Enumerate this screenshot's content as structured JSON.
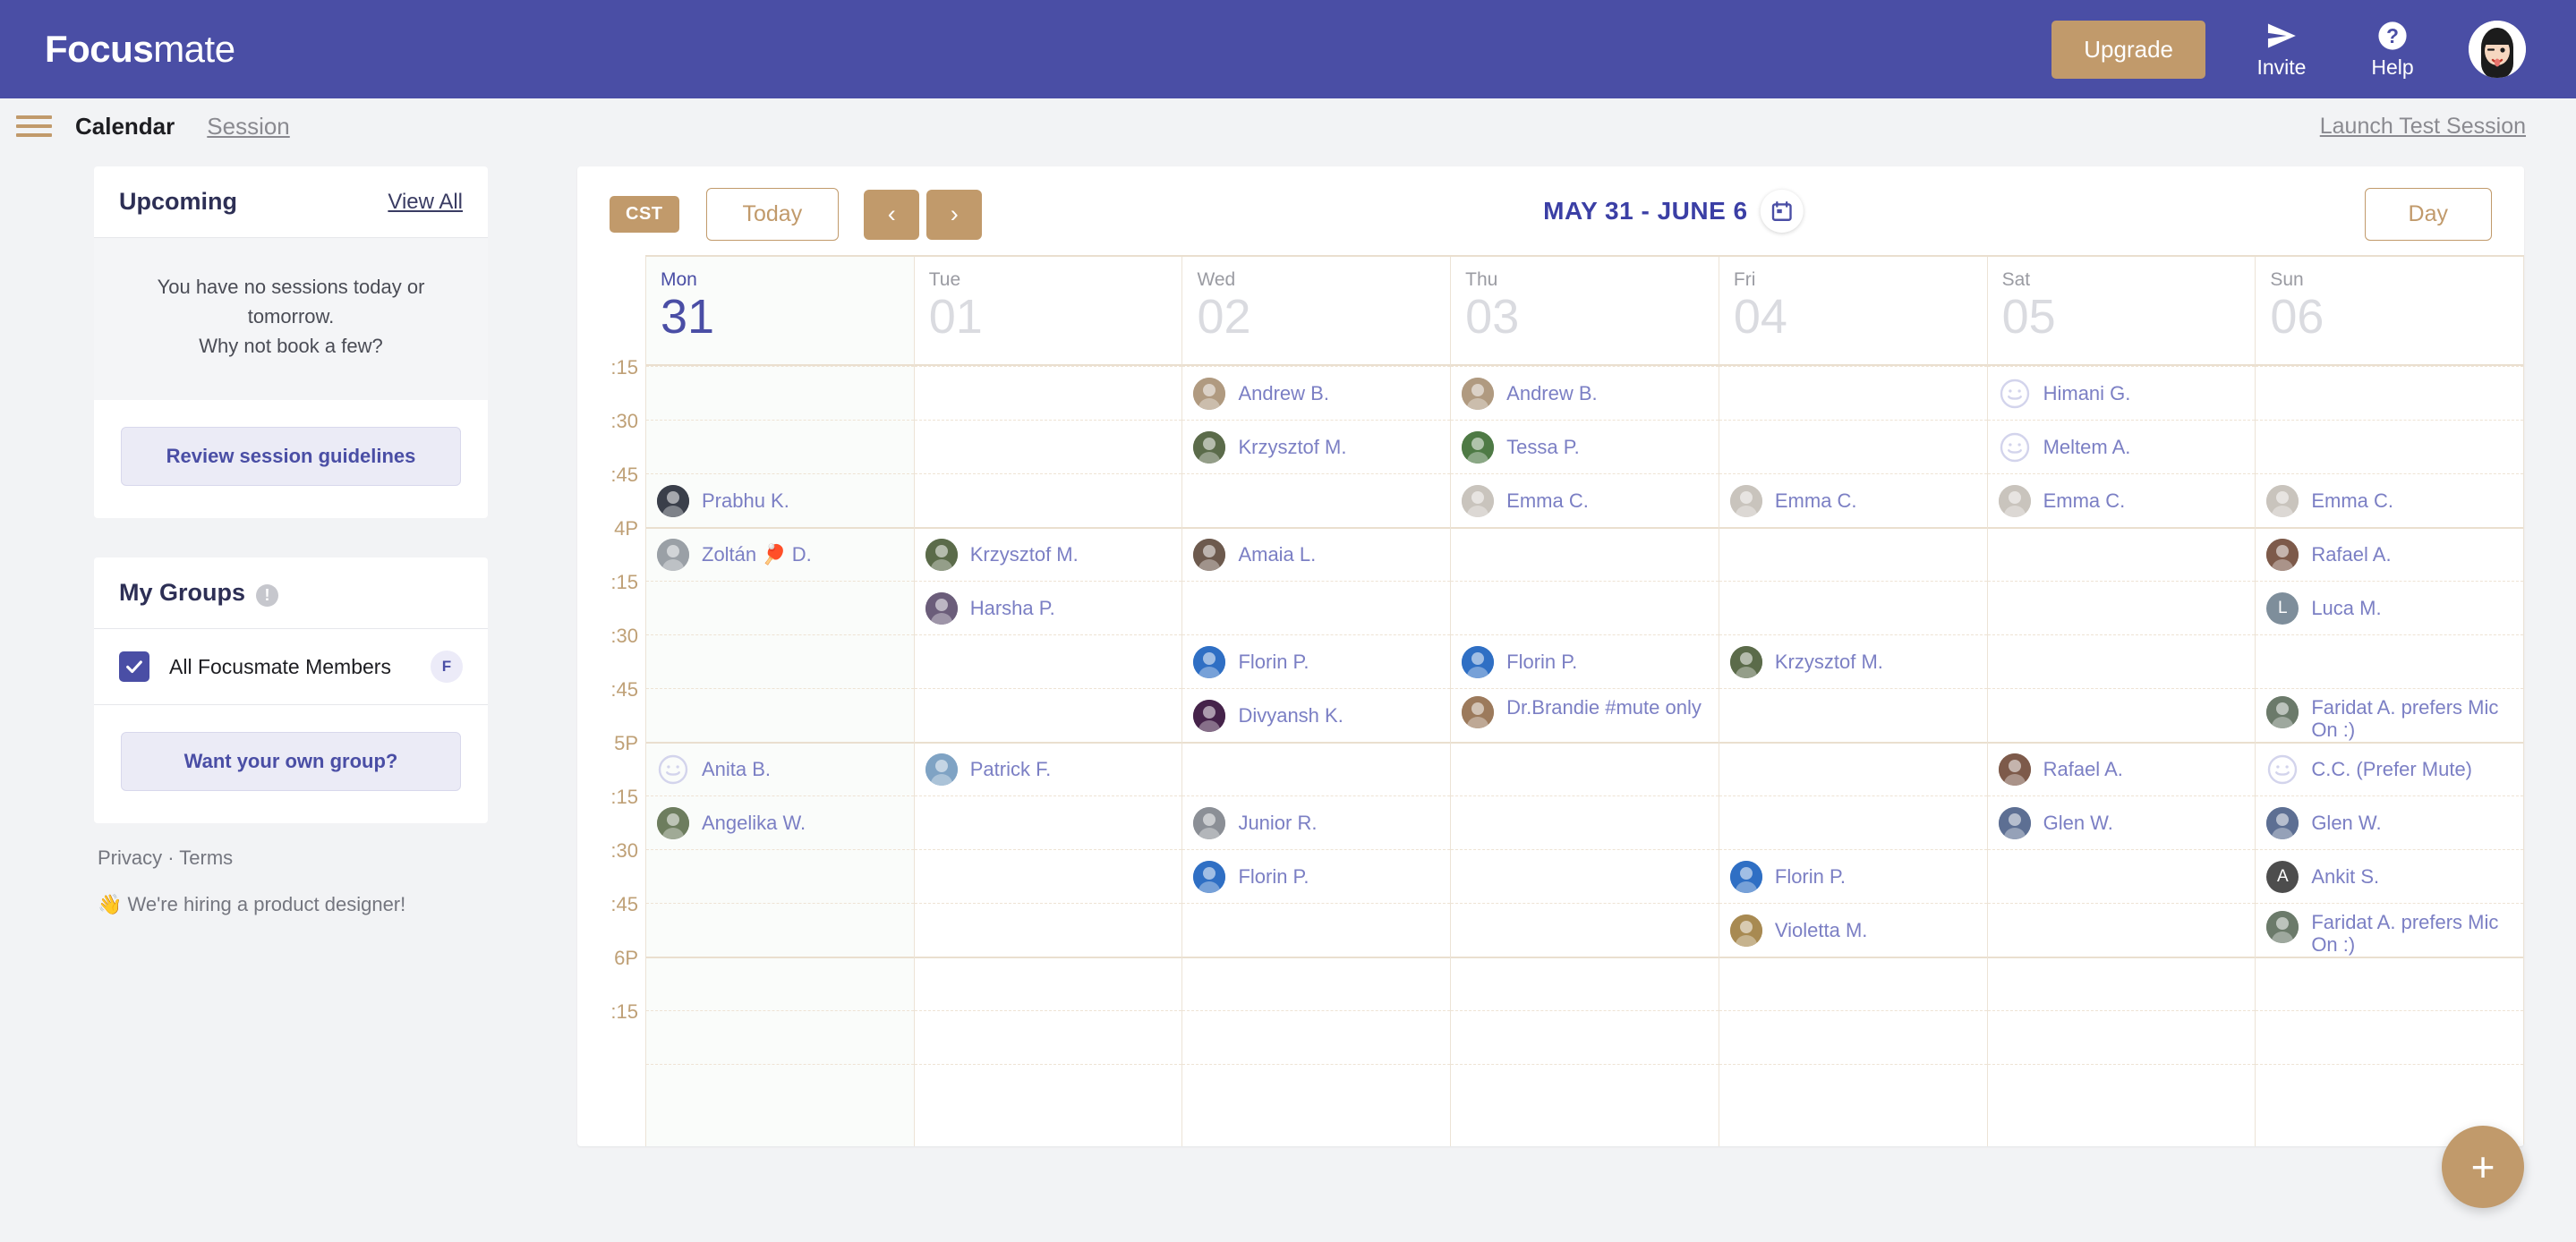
{
  "topnav": {
    "logo_bold": "Focus",
    "logo_light": "mate",
    "upgrade_label": "Upgrade",
    "invite_label": "Invite",
    "help_label": "Help",
    "invite_icon": "paper-plane-icon",
    "help_icon": "question-circle-icon",
    "avatar": "user-avatar",
    "bg_color": "#4a4ea5",
    "accent_color": "#c19a6b"
  },
  "subnav": {
    "menu_icon": "hamburger-menu-icon",
    "tabs": [
      {
        "label": "Calendar",
        "active": true
      },
      {
        "label": "Session",
        "active": false
      }
    ],
    "launch_test_session": "Launch Test Session"
  },
  "sidebar": {
    "upcoming": {
      "title": "Upcoming",
      "view_all": "View All",
      "empty_line1": "You have no sessions today or tomorrow.",
      "empty_line2": "Why not book a few?",
      "review_button": "Review session guidelines"
    },
    "groups": {
      "title": "My Groups",
      "info_icon": "info-icon",
      "items": [
        {
          "name": "All Focusmate Members",
          "checked": true,
          "badge": "F"
        }
      ],
      "own_group_button": "Want your own group?"
    },
    "footer": {
      "privacy": "Privacy",
      "separator": "·",
      "terms": "Terms",
      "hiring": "👋 We're hiring a product designer!"
    }
  },
  "calendar": {
    "timezone_badge": "CST",
    "today_label": "Today",
    "prev_icon": "chevron-left-icon",
    "next_icon": "chevron-right-icon",
    "prev_label": "‹",
    "next_label": "›",
    "date_range": "MAY 31 - JUNE 6",
    "date_picker_icon": "calendar-icon",
    "view_label": "Day",
    "add_session_label": "+",
    "time_labels": [
      ":15",
      ":30",
      ":45",
      "4P",
      ":15",
      ":30",
      ":45",
      "5P",
      ":15",
      ":30",
      ":45",
      "6P",
      ":15"
    ],
    "days": [
      {
        "dow": "Mon",
        "date": "31",
        "today": true
      },
      {
        "dow": "Tue",
        "date": "01",
        "today": false
      },
      {
        "dow": "Wed",
        "date": "02",
        "today": false
      },
      {
        "dow": "Thu",
        "date": "03",
        "today": false
      },
      {
        "dow": "Fri",
        "date": "04",
        "today": false
      },
      {
        "dow": "Sat",
        "date": "05",
        "today": false
      },
      {
        "dow": "Sun",
        "date": "06",
        "today": false
      }
    ],
    "sessions": [
      {
        "day": 0,
        "slot": 2,
        "name": "Prabhu K.",
        "avatar": "photo",
        "color": "#3a3f4a"
      },
      {
        "day": 0,
        "slot": 3,
        "name": "Zoltán 🏓 D.",
        "avatar": "photo",
        "color": "#9aa0a6"
      },
      {
        "day": 0,
        "slot": 7,
        "name": "Anita B.",
        "avatar": "smiley",
        "color": "#d3d4ec"
      },
      {
        "day": 0,
        "slot": 8,
        "name": "Angelika W.",
        "avatar": "photo",
        "color": "#6d7d5e"
      },
      {
        "day": 1,
        "slot": 3,
        "name": "Krzysztof M.",
        "avatar": "photo",
        "color": "#5b6b4a"
      },
      {
        "day": 1,
        "slot": 4,
        "name": "Harsha P.",
        "avatar": "photo",
        "color": "#6b5d7a"
      },
      {
        "day": 1,
        "slot": 7,
        "name": "Patrick F.",
        "avatar": "photo",
        "color": "#7fa3c4"
      },
      {
        "day": 2,
        "slot": 0,
        "name": "Andrew B.",
        "avatar": "photo",
        "color": "#b09a80"
      },
      {
        "day": 2,
        "slot": 1,
        "name": "Krzysztof M.",
        "avatar": "photo",
        "color": "#5b6b4a"
      },
      {
        "day": 2,
        "slot": 3,
        "name": "Amaia L.",
        "avatar": "photo",
        "color": "#6d5a4e"
      },
      {
        "day": 2,
        "slot": 5,
        "name": "Florin P.",
        "avatar": "photo",
        "color": "#2f6fc4"
      },
      {
        "day": 2,
        "slot": 6,
        "name": "Divyansh K.",
        "avatar": "photo",
        "color": "#45234a"
      },
      {
        "day": 2,
        "slot": 8,
        "name": "Junior R.",
        "avatar": "photo",
        "color": "#8b8f96"
      },
      {
        "day": 2,
        "slot": 9,
        "name": "Florin P.",
        "avatar": "photo",
        "color": "#2f6fc4"
      },
      {
        "day": 3,
        "slot": 0,
        "name": "Andrew B.",
        "avatar": "photo",
        "color": "#b09a80"
      },
      {
        "day": 3,
        "slot": 1,
        "name": "Tessa P.",
        "avatar": "photo",
        "color": "#4e7a45"
      },
      {
        "day": 3,
        "slot": 2,
        "name": "Emma C.",
        "avatar": "photo",
        "color": "#c9c4bd"
      },
      {
        "day": 3,
        "slot": 5,
        "name": "Florin P.",
        "avatar": "photo",
        "color": "#2f6fc4"
      },
      {
        "day": 3,
        "slot": 6,
        "name": "Dr.Brandie #mute only",
        "avatar": "photo",
        "color": "#9c7a5c",
        "two_line": true
      },
      {
        "day": 4,
        "slot": 2,
        "name": "Emma C.",
        "avatar": "photo",
        "color": "#c9c4bd"
      },
      {
        "day": 4,
        "slot": 5,
        "name": "Krzysztof M.",
        "avatar": "photo",
        "color": "#5b6b4a"
      },
      {
        "day": 4,
        "slot": 9,
        "name": "Florin P.",
        "avatar": "photo",
        "color": "#2f6fc4"
      },
      {
        "day": 4,
        "slot": 10,
        "name": "Violetta M.",
        "avatar": "photo",
        "color": "#a88a52"
      },
      {
        "day": 5,
        "slot": 0,
        "name": "Himani G.",
        "avatar": "smiley",
        "color": "#d3d4ec"
      },
      {
        "day": 5,
        "slot": 1,
        "name": "Meltem A.",
        "avatar": "smiley",
        "color": "#d3d4ec"
      },
      {
        "day": 5,
        "slot": 2,
        "name": "Emma C.",
        "avatar": "photo",
        "color": "#c9c4bd"
      },
      {
        "day": 5,
        "slot": 7,
        "name": "Rafael A.",
        "avatar": "photo",
        "color": "#7d5a4a"
      },
      {
        "day": 5,
        "slot": 8,
        "name": "Glen W.",
        "avatar": "photo",
        "color": "#5d6f93"
      },
      {
        "day": 6,
        "slot": 2,
        "name": "Emma C.",
        "avatar": "photo",
        "color": "#c9c4bd"
      },
      {
        "day": 6,
        "slot": 3,
        "name": "Rafael A.",
        "avatar": "photo",
        "color": "#7d5a4a"
      },
      {
        "day": 6,
        "slot": 4,
        "name": "Luca M.",
        "avatar": "letter",
        "letter": "L",
        "color": "#7e8e9b"
      },
      {
        "day": 6,
        "slot": 6,
        "name": "Faridat A. prefers Mic On :)",
        "avatar": "photo",
        "color": "#6b7a6a",
        "two_line": true
      },
      {
        "day": 6,
        "slot": 7,
        "name": "C.C. (Prefer Mute)",
        "avatar": "smiley",
        "color": "#d3d4ec"
      },
      {
        "day": 6,
        "slot": 8,
        "name": "Glen W.",
        "avatar": "photo",
        "color": "#5d6f93"
      },
      {
        "day": 6,
        "slot": 9,
        "name": "Ankit S.",
        "avatar": "letter",
        "letter": "A",
        "color": "#4d4d4d"
      },
      {
        "day": 6,
        "slot": 10,
        "name": "Faridat A. prefers Mic On :)",
        "avatar": "photo",
        "color": "#6b7a6a",
        "two_line": true
      }
    ]
  }
}
